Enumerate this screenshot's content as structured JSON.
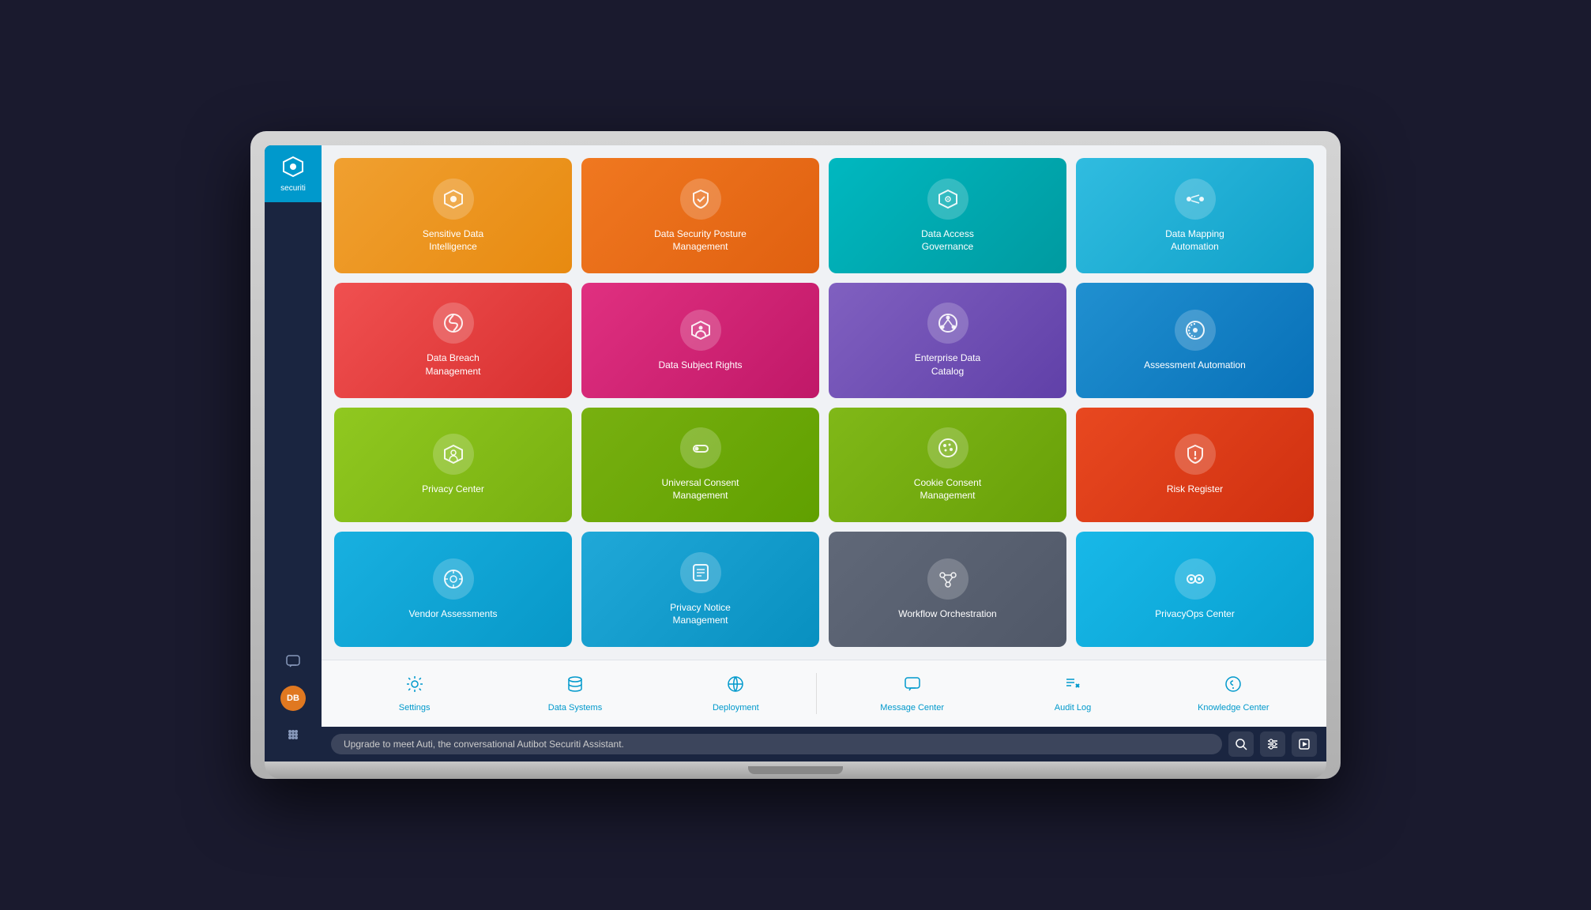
{
  "sidebar": {
    "logo_text": "securiti",
    "logo_icon": "⬡",
    "icons": [
      {
        "name": "chat-icon",
        "symbol": "💬"
      },
      {
        "name": "avatar",
        "initials": "DB"
      },
      {
        "name": "apps-icon",
        "symbol": "⋮⋮"
      }
    ]
  },
  "grid": {
    "rows": [
      [
        {
          "id": "sensitive-data-intelligence",
          "label": "Sensitive Data\nIntelligence",
          "color": "tile-orange",
          "icon": "⬡"
        },
        {
          "id": "data-security-posture-management",
          "label": "Data Security Posture\nManagement",
          "color": "tile-orange2",
          "icon": "🛡"
        },
        {
          "id": "data-access-governance",
          "label": "Data Access\nGovernance",
          "color": "tile-teal",
          "icon": "⬡"
        },
        {
          "id": "data-mapping-automation",
          "label": "Data Mapping\nAutomation",
          "color": "tile-blue-light",
          "icon": "⇆"
        }
      ],
      [
        {
          "id": "data-breach-management",
          "label": "Data Breach\nManagement",
          "color": "tile-red",
          "icon": "📡"
        },
        {
          "id": "data-subject-rights",
          "label": "Data Subject Rights",
          "color": "tile-pink",
          "icon": "⬡"
        },
        {
          "id": "enterprise-data-catalog",
          "label": "Enterprise Data\nCatalog",
          "color": "tile-purple",
          "icon": "⊕"
        },
        {
          "id": "assessment-automation",
          "label": "Assessment Automation",
          "color": "tile-blue2",
          "icon": "⟳"
        }
      ],
      [
        {
          "id": "privacy-center",
          "label": "Privacy Center",
          "color": "tile-green",
          "icon": "⬡"
        },
        {
          "id": "universal-consent-management",
          "label": "Universal Consent\nManagement",
          "color": "tile-green2",
          "icon": "⇌"
        },
        {
          "id": "cookie-consent-management",
          "label": "Cookie Consent\nManagement",
          "color": "tile-green3",
          "icon": "🎨"
        },
        {
          "id": "risk-register",
          "label": "Risk Register",
          "color": "tile-red2",
          "icon": "⚠"
        }
      ],
      [
        {
          "id": "vendor-assessments",
          "label": "Vendor Assessments",
          "color": "tile-cyan",
          "icon": "⚙"
        },
        {
          "id": "privacy-notice-management",
          "label": "Privacy Notice\nManagement",
          "color": "tile-cyan2",
          "icon": "☰"
        },
        {
          "id": "workflow-orchestration",
          "label": "Workflow Orchestration",
          "color": "tile-gray",
          "icon": "⋮"
        },
        {
          "id": "privacyops-center",
          "label": "PrivacyOps Center",
          "color": "tile-cyan3",
          "icon": "👁"
        }
      ]
    ]
  },
  "bottom_bar": {
    "items_left": [
      {
        "id": "settings",
        "label": "Settings",
        "icon": "⚙"
      },
      {
        "id": "data-systems",
        "label": "Data Systems",
        "icon": "🗄"
      },
      {
        "id": "deployment",
        "label": "Deployment",
        "icon": "⚙"
      }
    ],
    "items_right": [
      {
        "id": "message-center",
        "label": "Message Center",
        "icon": "💬"
      },
      {
        "id": "audit-log",
        "label": "Audit Log",
        "icon": "≡×"
      },
      {
        "id": "knowledge-center",
        "label": "Knowledge Center",
        "icon": "?"
      }
    ]
  },
  "status_bar": {
    "message": "Upgrade to meet Auti, the conversational Autibot Securiti Assistant.",
    "actions": [
      "🔍",
      "⚙",
      "▶"
    ]
  }
}
